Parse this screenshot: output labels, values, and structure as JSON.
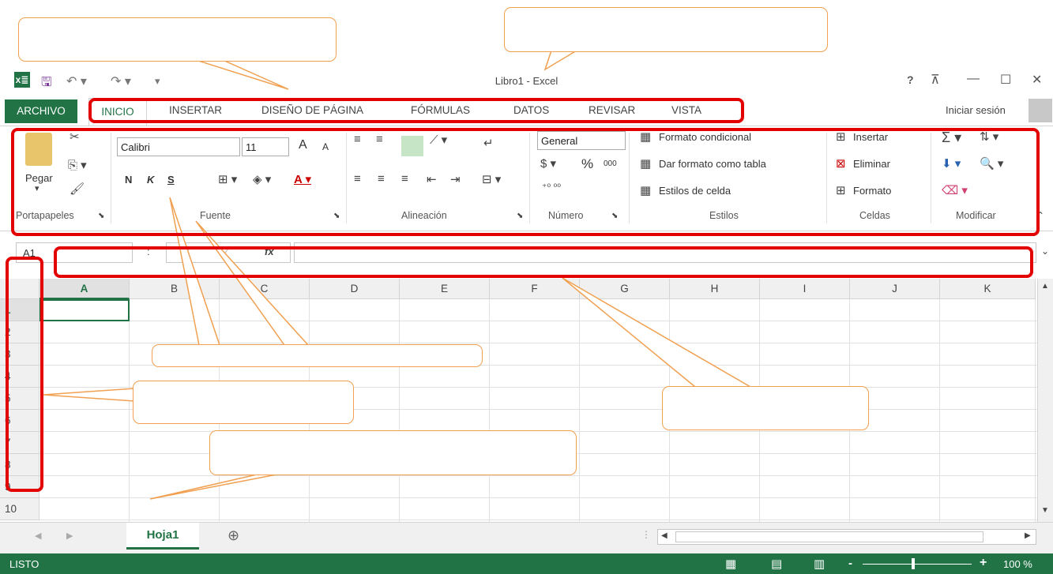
{
  "window": {
    "title": "Libro1 - Excel",
    "help": "?",
    "signin": "Iniciar sesión"
  },
  "tabs": {
    "archivo": "ARCHIVO",
    "inicio": "INICIO",
    "insertar": "INSERTAR",
    "diseno": "DISEÑO DE PÁGINA",
    "formulas": "FÓRMULAS",
    "datos": "DATOS",
    "revisar": "REVISAR",
    "vista": "VISTA"
  },
  "ribbon": {
    "portapapeles": {
      "label": "Portapapeles",
      "pegar": "Pegar"
    },
    "fuente": {
      "label": "Fuente",
      "font": "Calibri",
      "size": "11",
      "bold": "N",
      "italic": "K",
      "underline": "S",
      "grow": "A",
      "shrink": "A"
    },
    "alineacion": {
      "label": "Alineación"
    },
    "numero": {
      "label": "Número",
      "format": "General",
      "percent": "%",
      "thousands": "000"
    },
    "estilos": {
      "label": "Estilos",
      "cond": "Formato condicional",
      "table": "Dar formato como tabla",
      "cell": "Estilos de celda"
    },
    "celdas": {
      "label": "Celdas",
      "insertar": "Insertar",
      "eliminar": "Eliminar",
      "formato": "Formato"
    },
    "modificar": {
      "label": "Modificar"
    }
  },
  "formula_bar": {
    "name_box": "A1",
    "fx": "fx",
    "colon": ":"
  },
  "columns": [
    "A",
    "B",
    "C",
    "D",
    "E",
    "F",
    "G",
    "H",
    "I",
    "J",
    "K"
  ],
  "rows": [
    "1",
    "2",
    "3",
    "4",
    "5",
    "6",
    "7",
    "8",
    "9",
    "10"
  ],
  "sheet": {
    "name": "Hoja1",
    "add": "⊕"
  },
  "status": {
    "ready": "LISTO",
    "zoom": "100 %",
    "zoom_minus": "-",
    "zoom_plus": "+"
  },
  "colors": {
    "accent": "#217346",
    "annotation_red": "#e20000",
    "callout_border": "#f0a050"
  }
}
